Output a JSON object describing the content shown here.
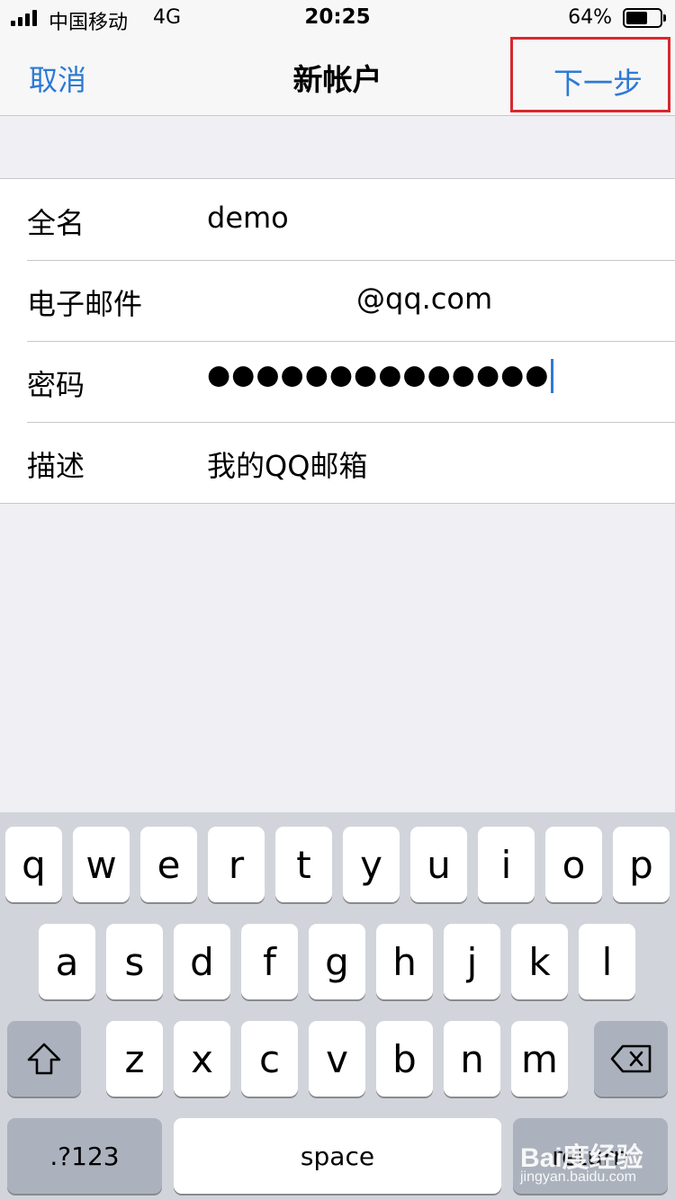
{
  "status_bar": {
    "carrier": "中国移动",
    "network": "4G",
    "time": "20:25",
    "battery_percent": "64%",
    "battery_level": 0.64
  },
  "nav": {
    "cancel": "取消",
    "title": "新帐户",
    "next": "下一步",
    "highlight_color": "#d7282e",
    "accent_color": "#2d7ad6"
  },
  "form": {
    "rows": [
      {
        "label": "全名",
        "value": "demo"
      },
      {
        "label": "电子邮件",
        "value": "@qq.com"
      },
      {
        "label": "密码",
        "value": "●●●●●●●●●●●●●●"
      },
      {
        "label": "描述",
        "value": "我的QQ邮箱"
      }
    ]
  },
  "keyboard": {
    "row1": [
      "q",
      "w",
      "e",
      "r",
      "t",
      "y",
      "u",
      "i",
      "o",
      "p"
    ],
    "row2": [
      "a",
      "s",
      "d",
      "f",
      "g",
      "h",
      "j",
      "k",
      "l"
    ],
    "row3": [
      "z",
      "x",
      "c",
      "v",
      "b",
      "n",
      "m"
    ],
    "shift_icon": "shift-arrow-icon",
    "delete_icon": "backspace-icon",
    "numbers": ".?123",
    "space": "space",
    "return": "return"
  },
  "watermark": {
    "brand": "Bai度经验",
    "url": "jingyan.baidu.com"
  }
}
